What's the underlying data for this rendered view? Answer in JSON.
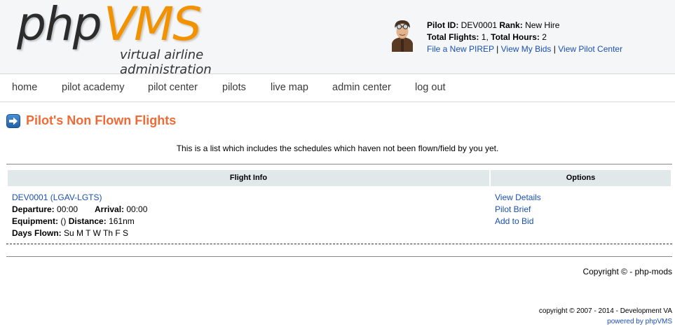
{
  "logo": {
    "php": "php",
    "vms": "VMS",
    "subtitle": "virtual airline administration"
  },
  "pilot": {
    "id_label": "Pilot ID:",
    "id_value": "DEV0001",
    "rank_label": "Rank:",
    "rank_value": "New Hire",
    "flights_label": "Total Flights:",
    "flights_value": "1,",
    "hours_label": "Total Hours:",
    "hours_value": "2",
    "links": [
      {
        "label": "File a New PIREP"
      },
      {
        "label": "View My Bids"
      },
      {
        "label": "View Pilot Center"
      }
    ],
    "separator": "|"
  },
  "nav": {
    "items": [
      {
        "label": "home"
      },
      {
        "label": "pilot academy"
      },
      {
        "label": "pilot center"
      },
      {
        "label": "pilots"
      },
      {
        "label": "live map"
      },
      {
        "label": "admin center"
      },
      {
        "label": "log out"
      }
    ]
  },
  "page": {
    "title": "Pilot's Non Flown Flights",
    "intro": "This is a list which includes the schedules which haven not been flown/field by you yet."
  },
  "table": {
    "headers": [
      "Flight Info",
      "Options"
    ],
    "rows": [
      {
        "flight_link": "DEV0001 (LGAV-LGTS)",
        "departure_label": "Departure:",
        "departure_value": "00:00",
        "arrival_label": "Arrival:",
        "arrival_value": "00:00",
        "equipment_label": "Equipment:",
        "equipment_value": "()",
        "distance_label": "Distance:",
        "distance_value": "161nm",
        "days_label": "Days Flown:",
        "days_value": "Su M T W Th F S",
        "options": [
          "View Details",
          "Pilot Brief",
          "Add to Bid"
        ]
      }
    ]
  },
  "footer": {
    "copyright": "Copyright © - php-mods",
    "site_copyright": "copyright © 2007 - 2014 - Development VA",
    "powered": "powered by phpVMS"
  },
  "colors": {
    "accent": "#f39200",
    "title": "#f06a35",
    "link": "#1a4fb4",
    "header_bg": "#f4f6f8",
    "table_header_bg": "#e1e8ea"
  }
}
